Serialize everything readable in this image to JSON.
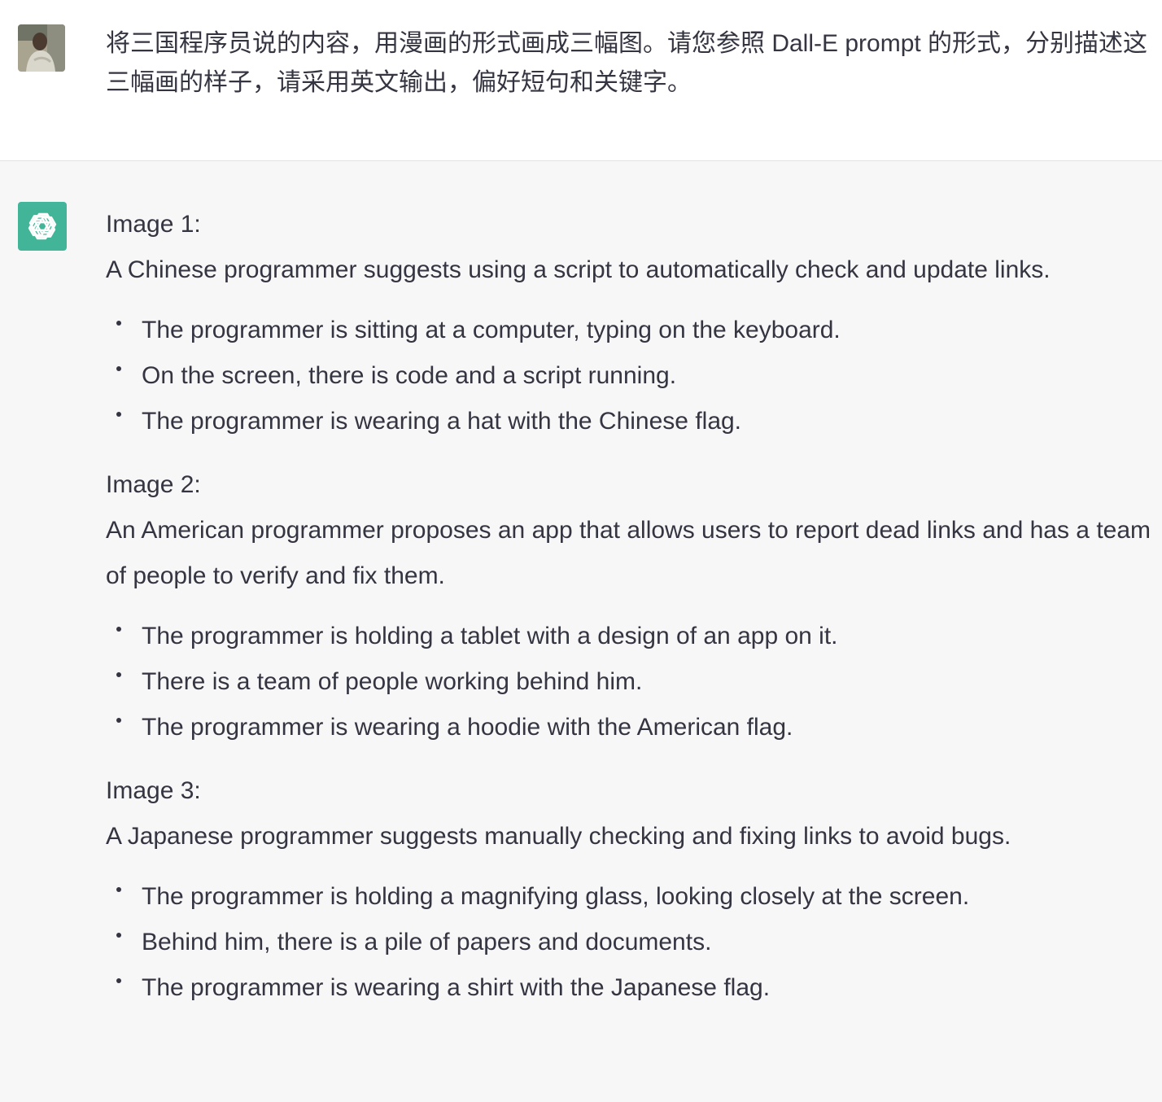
{
  "user_message": {
    "avatar": "user-photo-avatar",
    "text": "将三国程序员说的内容，用漫画的形式画成三幅图。请您参照 Dall-E prompt 的形式，分别描述这三幅画的样子，请采用英文输出，偏好短句和关键字。"
  },
  "assistant_message": {
    "avatar": "openai-logo-icon",
    "accent_color": "#10a37f",
    "sections": [
      {
        "heading": "Image 1:",
        "summary": "A Chinese programmer suggests using a script to automatically check and update links.",
        "bullets": [
          "The programmer is sitting at a computer, typing on the keyboard.",
          "On the screen, there is code and a script running.",
          "The programmer is wearing a hat with the Chinese flag."
        ]
      },
      {
        "heading": "Image 2:",
        "summary": "An American programmer proposes an app that allows users to report dead links and has a team of people to verify and fix them.",
        "bullets": [
          "The programmer is holding a tablet with a design of an app on it.",
          "There is a team of people working behind him.",
          "The programmer is wearing a hoodie with the American flag."
        ]
      },
      {
        "heading": "Image 3:",
        "summary": "A Japanese programmer suggests manually checking and fixing links to avoid bugs.",
        "bullets": [
          "The programmer is holding a magnifying glass, looking closely at the screen.",
          "Behind him, there is a pile of papers and documents.",
          "The programmer is wearing a shirt with the Japanese flag."
        ]
      }
    ]
  }
}
